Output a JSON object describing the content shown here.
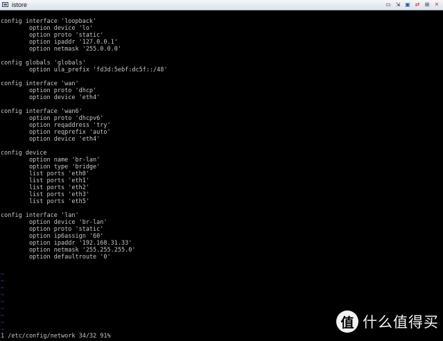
{
  "window": {
    "title": "istore",
    "controls": [
      "▭",
      "⇲",
      "▣",
      "⇄",
      "⊞",
      "✕"
    ]
  },
  "terminal": {
    "lines": [
      "config interface 'loopback'",
      "        option device 'lo'",
      "        option proto 'static'",
      "        option ipaddr '127.0.0.1'",
      "        option netmask '255.0.0.0'",
      "",
      "config globals 'globals'",
      "        option ula_prefix 'fd3d:5ebf:dc5f::/48'",
      "",
      "config interface 'wan'",
      "        option proto 'dhcp'",
      "        option device 'eth4'",
      "",
      "config interface 'wan6'",
      "        option proto 'dhcpv6'",
      "        option reqaddress 'try'",
      "        option reqprefix 'auto'",
      "        option device 'eth4'",
      "",
      "config device",
      "        option name 'br-lan'",
      "        option type 'bridge'",
      "        list ports 'eth0'",
      "        list ports 'eth1'",
      "        list ports 'eth2'",
      "        list ports 'eth3'",
      "        list ports 'eth5'",
      "",
      "config interface 'lan'",
      "        option device 'br-lan'",
      "        option proto 'static'",
      "        option ip6assign '60'",
      "        option ipaddr '192.168.31.33'",
      "        option netmask '255.255.255.0'",
      "        option defaultroute '0'"
    ],
    "empty_marker": "~",
    "empty_line_count": 9,
    "status_line": "1 /etc/config/network 34/32 91%"
  },
  "watermark": {
    "logo_char": "值",
    "text": "什么值得买"
  }
}
